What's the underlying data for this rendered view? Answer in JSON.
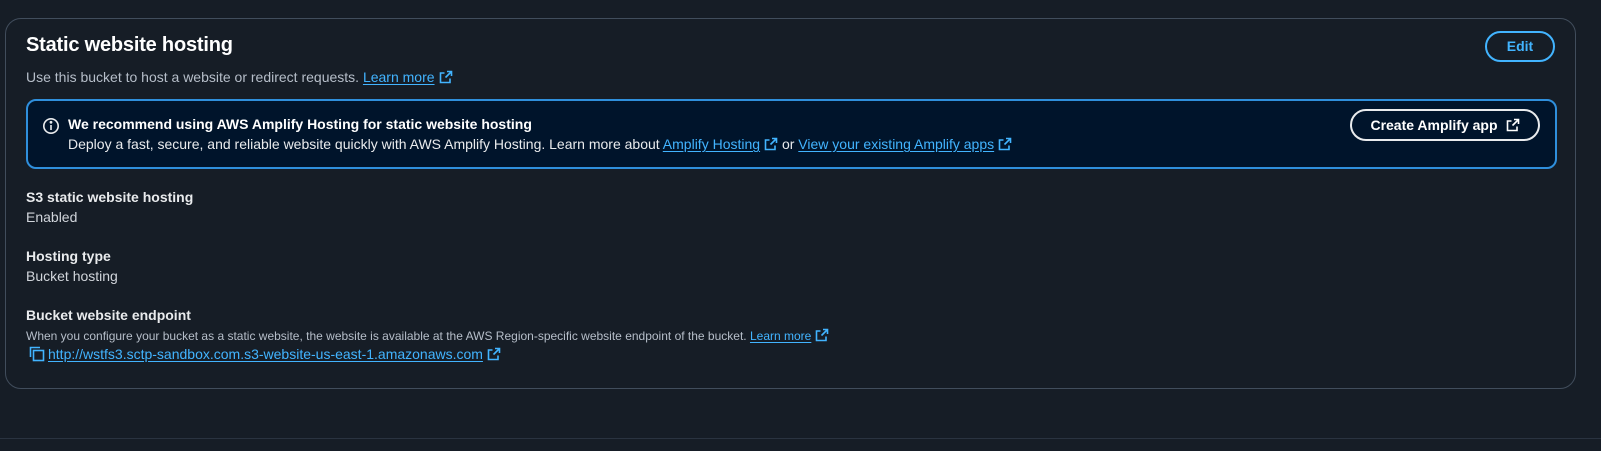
{
  "section": {
    "title": "Static website hosting",
    "description": "Use this bucket to host a website or redirect requests.",
    "learn_more": "Learn more",
    "edit_label": "Edit"
  },
  "alert": {
    "title": "We recommend using AWS Amplify Hosting for static website hosting",
    "body_prefix": "Deploy a fast, secure, and reliable website quickly with AWS Amplify Hosting. Learn more about",
    "link1": "Amplify Hosting",
    "connector": "or",
    "link2": "View your existing Amplify apps",
    "button_label": "Create Amplify app",
    "icon": "info-icon"
  },
  "fields": {
    "hosting_status": {
      "label": "S3 static website hosting",
      "value": "Enabled"
    },
    "hosting_type": {
      "label": "Hosting type",
      "value": "Bucket hosting"
    },
    "endpoint": {
      "label": "Bucket website endpoint",
      "description": "When you configure your bucket as a static website, the website is available at the AWS Region-specific website endpoint of the bucket.",
      "learn_more": "Learn more",
      "url": "http://wstfs3.sctp-sandbox.com.s3-website-us-east-1.amazonaws.com"
    }
  },
  "colors": {
    "background": "#161d26",
    "link": "#42b4ff",
    "alert_border": "#2f8fdc",
    "alert_background": "#00142b"
  }
}
